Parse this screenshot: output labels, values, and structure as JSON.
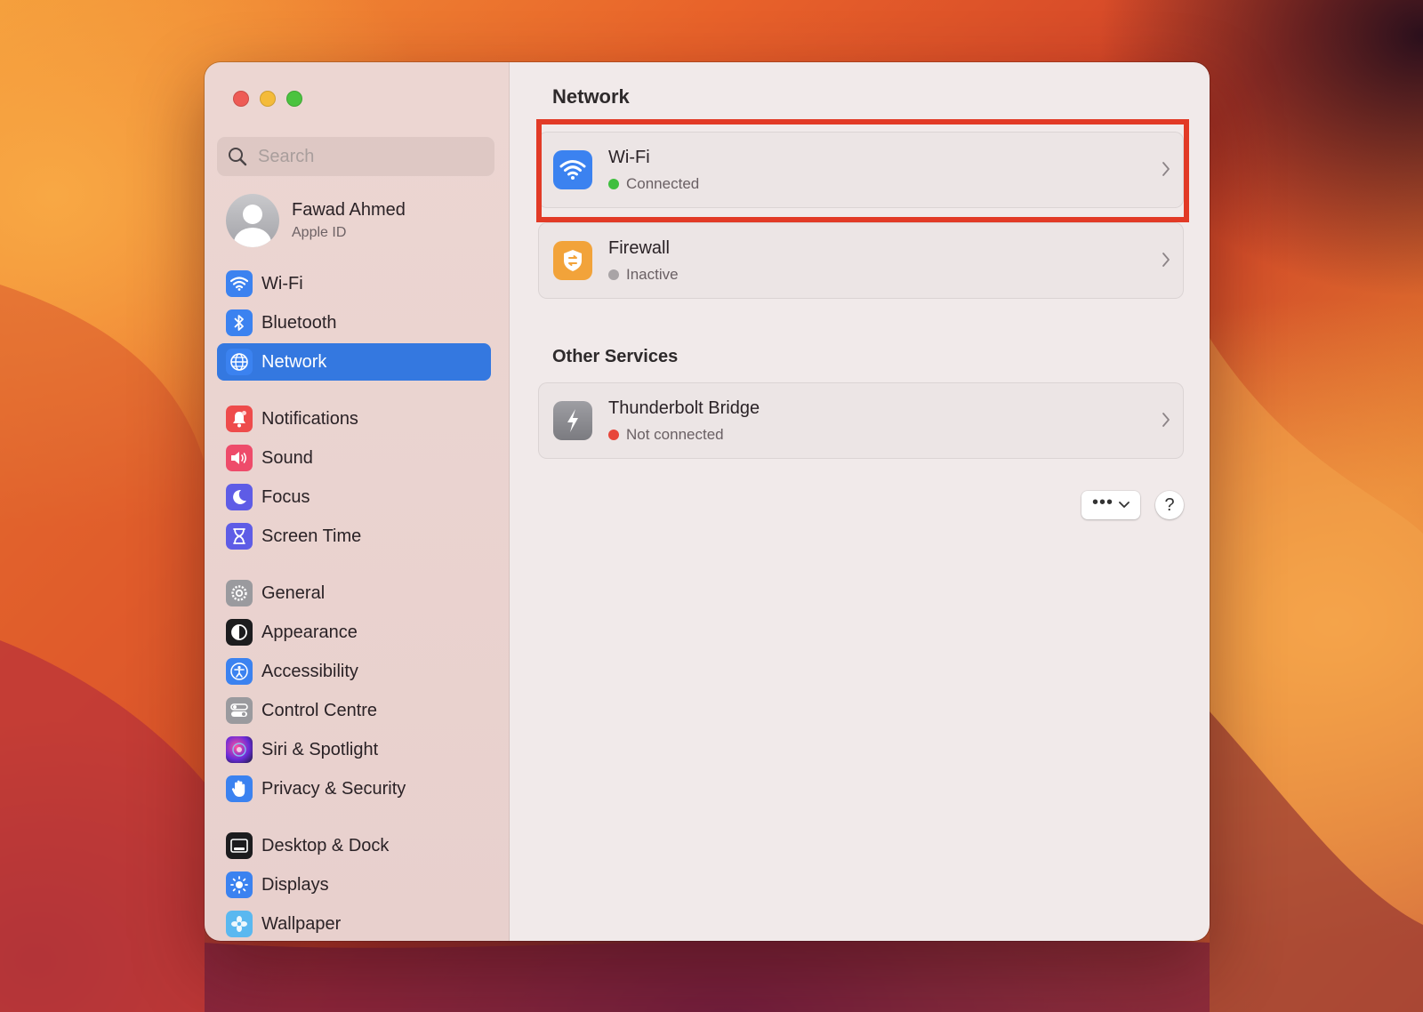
{
  "window": {
    "title": "Network"
  },
  "sidebar": {
    "search_placeholder": "Search",
    "profile": {
      "name": "Fawad Ahmed",
      "subtitle": "Apple ID"
    },
    "items": [
      {
        "label": "Wi-Fi",
        "icon": "wifi-icon",
        "color": "#3b82f0",
        "active": false
      },
      {
        "label": "Bluetooth",
        "icon": "bluetooth-icon",
        "color": "#3b82f0",
        "active": false
      },
      {
        "label": "Network",
        "icon": "globe-icon",
        "color": "#3b82f0",
        "active": true
      },
      {
        "label": "Notifications",
        "icon": "bell-icon",
        "color": "#ee4b4b",
        "active": false
      },
      {
        "label": "Sound",
        "icon": "speaker-icon",
        "color": "#ee4b6a",
        "active": false
      },
      {
        "label": "Focus",
        "icon": "moon-icon",
        "color": "#5e5ce6",
        "active": false
      },
      {
        "label": "Screen Time",
        "icon": "hourglass-icon",
        "color": "#5e5ce6",
        "active": false
      },
      {
        "label": "General",
        "icon": "gear-icon",
        "color": "#9a9a9e",
        "active": false
      },
      {
        "label": "Appearance",
        "icon": "appearance-icon",
        "color": "#1c1c1e",
        "active": false
      },
      {
        "label": "Accessibility",
        "icon": "accessibility-icon",
        "color": "#3b82f0",
        "active": false
      },
      {
        "label": "Control Centre",
        "icon": "control-centre-icon",
        "color": "#9a9a9e",
        "active": false
      },
      {
        "label": "Siri & Spotlight",
        "icon": "siri-icon",
        "color": "#7a3ed8",
        "active": false
      },
      {
        "label": "Privacy & Security",
        "icon": "hand-icon",
        "color": "#3b82f0",
        "active": false
      },
      {
        "label": "Desktop & Dock",
        "icon": "dock-icon",
        "color": "#1c1c1e",
        "active": false
      },
      {
        "label": "Displays",
        "icon": "sun-icon",
        "color": "#3b82f0",
        "active": false
      },
      {
        "label": "Wallpaper",
        "icon": "flower-icon",
        "color": "#5ab8f0",
        "active": false
      }
    ]
  },
  "main": {
    "title": "Network",
    "services": [
      {
        "name": "Wi-Fi",
        "status": "Connected",
        "status_color": "#3fbf3f",
        "icon": "wifi-icon",
        "icon_color": "#3b82f0"
      },
      {
        "name": "Firewall",
        "status": "Inactive",
        "status_color": "#a9a4a6",
        "icon": "firewall-icon",
        "icon_color": "#f2a33a"
      }
    ],
    "other_title": "Other Services",
    "other_services": [
      {
        "name": "Thunderbolt Bridge",
        "status": "Not connected",
        "status_color": "#e8463a",
        "icon": "thunderbolt-icon",
        "icon_color": "#8e8e93"
      }
    ],
    "more_label": "•••",
    "help_label": "?"
  }
}
